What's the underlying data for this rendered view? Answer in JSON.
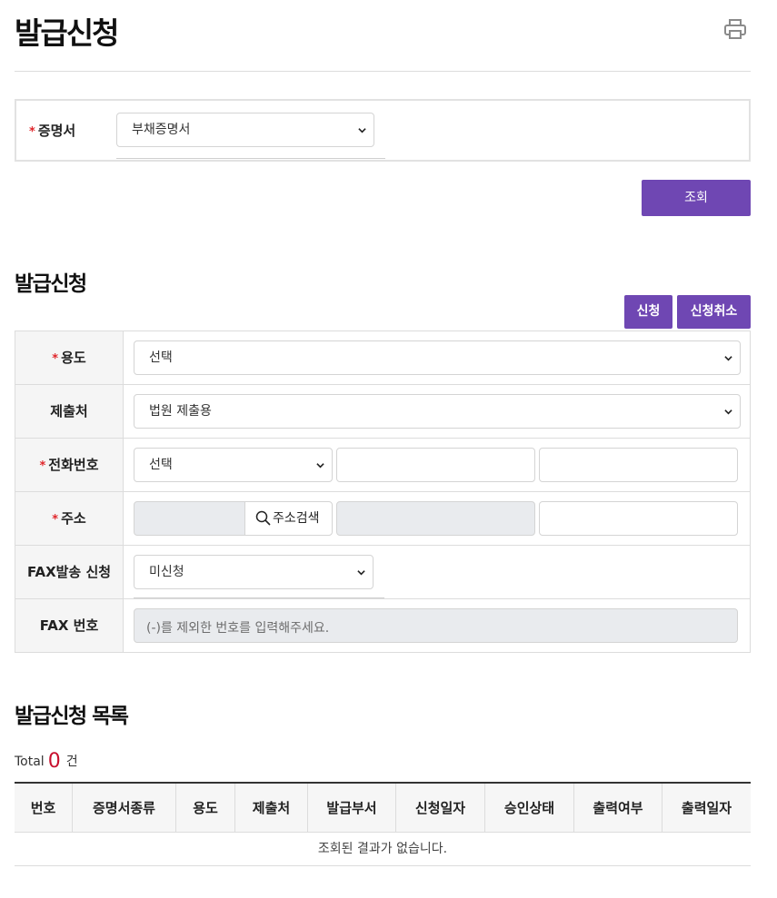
{
  "page_title": "발급신청",
  "certificate": {
    "label": "증명서",
    "required_mark": "*",
    "selected": "부채증명서"
  },
  "search_button": "조회",
  "apply_section": {
    "title": "발급신청",
    "apply_button": "신청",
    "cancel_button": "신청취소",
    "fields": {
      "purpose": {
        "label": "용도",
        "required_mark": "*",
        "selected": "선택"
      },
      "submit_to": {
        "label": "제출처",
        "selected": "법원 제출용"
      },
      "phone": {
        "label": "전화번호",
        "required_mark": "*",
        "selected": "선택",
        "part2": "",
        "part3": ""
      },
      "address": {
        "label": "주소",
        "required_mark": "*",
        "zip": "",
        "search_button": "주소검색",
        "addr1": "",
        "addr2": ""
      },
      "fax_request": {
        "label": "FAX발송 신청",
        "selected": "미신청"
      },
      "fax_number": {
        "label": "FAX 번호",
        "placeholder": "(-)를 제외한 번호를 입력해주세요."
      }
    }
  },
  "list_section": {
    "title": "발급신청 목록",
    "total_label": "Total",
    "total_count": "0",
    "count_unit": "건",
    "columns": [
      "번호",
      "증명서종류",
      "용도",
      "제출처",
      "발급부서",
      "신청일자",
      "승인상태",
      "출력여부",
      "출력일자"
    ],
    "empty_message": "조회된 결과가 없습니다."
  },
  "colors": {
    "accent": "#6f47b3",
    "required": "#e0262b",
    "total_count": "#c8102e"
  },
  "icons": {
    "print": "printer-icon",
    "search": "magnifier-icon",
    "select": "chevron-down-icon"
  }
}
